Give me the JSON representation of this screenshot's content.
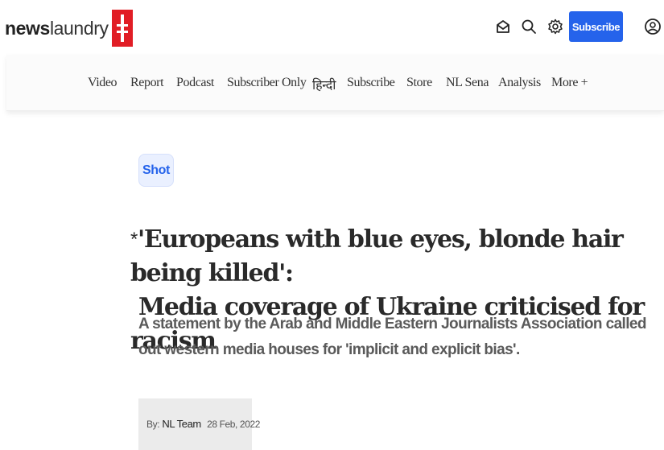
{
  "header": {
    "logo_bold": "news",
    "logo_light": "laundry",
    "subscribe_label": "Subscribe",
    "icons": [
      "newsletter-icon",
      "search-icon",
      "settings-icon",
      "profile-icon"
    ]
  },
  "nav": {
    "items": [
      "Video",
      "Report",
      "Podcast",
      "Subscriber Only",
      "हिन्दी",
      "Subscribe",
      "Store",
      "NL Sena",
      "Analysis",
      "More +"
    ]
  },
  "article": {
    "tag": "Shot",
    "headline_star": "*",
    "headline_line1": "'Europeans with blue eyes, blonde hair being killed':",
    "headline_line2": "Media coverage of Ukraine criticised for racism",
    "dek": "A statement by the Arab and Middle Eastern Journalists Association called out western media houses for 'implicit and explicit bias'.",
    "byline_prefix": "By:",
    "author": "NL Team",
    "date": "28 Feb, 2022"
  },
  "colors": {
    "brand_red": "#e11d25",
    "accent_blue": "#2563eb",
    "tag_bg": "#eaf0ff"
  }
}
